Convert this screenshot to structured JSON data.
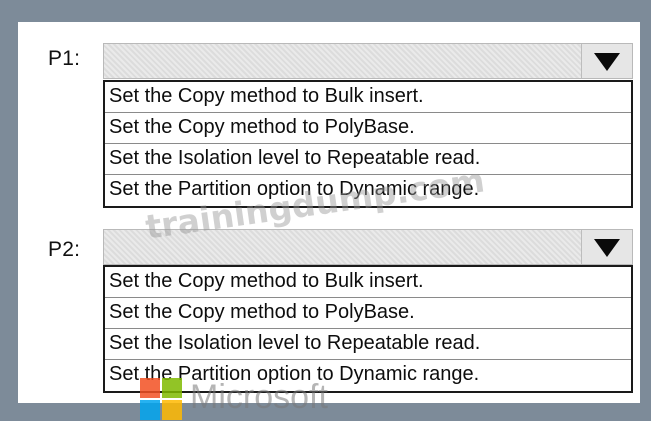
{
  "p1": {
    "label": "P1:",
    "selected": "",
    "options": [
      "Set the Copy method to Bulk insert.",
      "Set the Copy method to PolyBase.",
      "Set the Isolation level to Repeatable read.",
      "Set the Partition option to Dynamic range."
    ]
  },
  "p2": {
    "label": "P2:",
    "selected": "",
    "options": [
      "Set the Copy method to Bulk insert.",
      "Set the Copy method to PolyBase.",
      "Set the Isolation level to Repeatable read.",
      "Set the Partition option to Dynamic range."
    ]
  },
  "watermark": {
    "text": "trainingdump.com",
    "logo_text": "Microsoft"
  },
  "icons": {
    "dropdown_arrow": "triangle-down-icon",
    "logo": "microsoft-logo-icon"
  },
  "colors": {
    "frame": "#7d8b99",
    "logo_red": "#f25022",
    "logo_green": "#7fba00",
    "logo_blue": "#00a4ef",
    "logo_yellow": "#ffb900"
  }
}
